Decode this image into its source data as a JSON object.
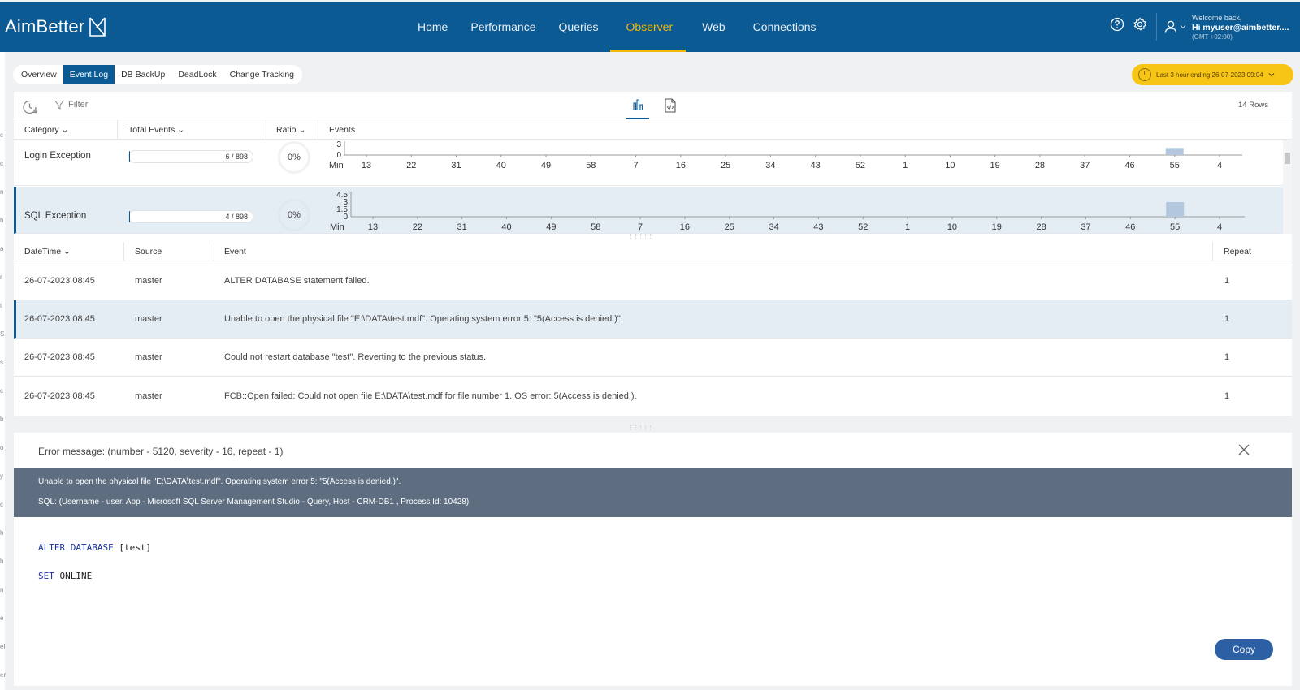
{
  "app": {
    "logo": "AimBetter",
    "nav": [
      "Home",
      "Performance",
      "Queries",
      "Observer",
      "Web",
      "Connections"
    ],
    "active_nav": "Observer",
    "user": {
      "welcome": "Welcome back,",
      "name": "Hi myuser@aimbetter....",
      "tz": "(GMT +02:00)"
    },
    "accent": "#0b5a93",
    "highlight": "#f5b800"
  },
  "subtabs": [
    "Overview",
    "Event Log",
    "DB BackUp",
    "DeadLock",
    "Change Tracking"
  ],
  "time_range": "Last 3 hour ending  26-07-2023 09:04",
  "toolbar": {
    "filter": "Filter",
    "rows": "14 Rows"
  },
  "chart_table": {
    "headers": {
      "category": "Category",
      "total": "Total Events",
      "ratio": "Ratio",
      "events": "Events"
    },
    "rows": [
      {
        "category": "Login Exception",
        "count": 6,
        "total": 898,
        "count_label": "6 / 898",
        "ratio": "0%",
        "y_ticks": [
          "3",
          "0"
        ],
        "bar_value": 2,
        "y_max": 3
      },
      {
        "category": "SQL Exception",
        "count": 4,
        "total": 898,
        "count_label": "4 / 898",
        "ratio": "0%",
        "y_ticks": [
          "4.5",
          "3",
          "1.5",
          "0"
        ],
        "bar_value": 3,
        "y_max": 4.5
      }
    ],
    "x_axis_label": "Min",
    "x_ticks": [
      "13",
      "22",
      "31",
      "40",
      "49",
      "58",
      "7",
      "16",
      "25",
      "34",
      "43",
      "52",
      "1",
      "10",
      "19",
      "28",
      "37",
      "46",
      "55",
      "4"
    ],
    "bar_x_tick": "55"
  },
  "events": {
    "headers": {
      "datetime": "DateTime",
      "source": "Source",
      "event": "Event",
      "repeat": "Repeat"
    },
    "rows": [
      {
        "datetime": "26-07-2023 08:45",
        "source": "master",
        "event": "ALTER DATABASE statement failed.",
        "repeat": "1"
      },
      {
        "datetime": "26-07-2023 08:45",
        "source": "master",
        "event": "Unable to open the physical file \"E:\\DATA\\test.mdf\". Operating system error 5: \"5(Access is denied.)\".",
        "repeat": "1"
      },
      {
        "datetime": "26-07-2023 08:45",
        "source": "master",
        "event": "Could not restart database \"test\". Reverting to the previous status.",
        "repeat": "1"
      },
      {
        "datetime": "26-07-2023 08:45",
        "source": "master",
        "event": "FCB::Open failed: Could not open file E:\\DATA\\test.mdf for file number 1. OS error: 5(Access is denied.).",
        "repeat": "1"
      }
    ]
  },
  "error": {
    "title": "Error message: (number - 5120, severity - 16, repeat - 1)",
    "line1": "Unable to open the physical file \"E:\\DATA\\test.mdf\". Operating system error 5: \"5(Access is denied.)\".",
    "line2": "SQL: (Username - user, App - Microsoft SQL Server Management Studio - Query, Host - CRM-DB1 , Process Id: 10428)",
    "code": [
      {
        "kw": "ALTER DATABASE",
        "rest": " [test]"
      },
      {
        "kw": "SET",
        "rest": " ONLINE"
      }
    ],
    "copy": "Copy"
  },
  "left_rail_letters": [
    "c",
    "c",
    "n",
    "h",
    "a",
    "r",
    "t",
    "S",
    "s",
    "c",
    "b",
    "o",
    "y",
    "c",
    "h",
    "h",
    "n",
    "e",
    "el",
    "er"
  ]
}
